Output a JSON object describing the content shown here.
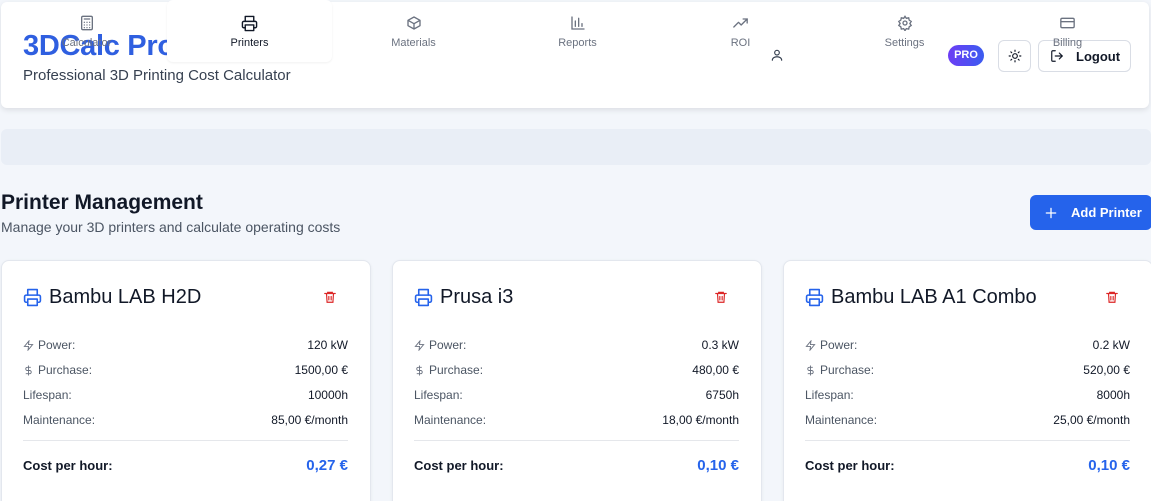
{
  "header": {
    "title": "3DCalc Pro",
    "subtitle": "Professional 3D Printing Cost Calculator",
    "badge": "PRO",
    "logout_label": "Logout",
    "icons": [
      "user-icon",
      "sun-icon",
      "logout-icon"
    ]
  },
  "tabs": [
    {
      "label": "Calculator",
      "icon": "calculator-icon",
      "active": false
    },
    {
      "label": "Printers",
      "icon": "printer-icon",
      "active": true
    },
    {
      "label": "Materials",
      "icon": "box-icon",
      "active": false
    },
    {
      "label": "Reports",
      "icon": "bar-chart-icon",
      "active": false
    },
    {
      "label": "ROI",
      "icon": "trending-up-icon",
      "active": false
    },
    {
      "label": "Settings",
      "icon": "gear-icon",
      "active": false
    },
    {
      "label": "Billing",
      "icon": "credit-card-icon",
      "active": false
    }
  ],
  "page": {
    "title": "Printer Management",
    "subtitle": "Manage your 3D printers and calculate operating costs",
    "add_button": "Add Printer"
  },
  "labels": {
    "power": "Power:",
    "purchase": "Purchase:",
    "lifespan": "Lifespan:",
    "maintenance": "Maintenance:",
    "cost_per_hour": "Cost per hour:"
  },
  "printers": [
    {
      "name": "Bambu LAB H2D",
      "power": "120 kW",
      "purchase": "1500,00 €",
      "lifespan": "10000h",
      "maintenance": "85,00 €/month",
      "cost_per_hour": "0,27 €"
    },
    {
      "name": "Prusa i3",
      "power": "0.3 kW",
      "purchase": "480,00 €",
      "lifespan": "6750h",
      "maintenance": "18,00 €/month",
      "cost_per_hour": "0,10 €"
    },
    {
      "name": "Bambu LAB A1 Combo",
      "power": "0.2 kW",
      "purchase": "520,00 €",
      "lifespan": "8000h",
      "maintenance": "25,00 €/month",
      "cost_per_hour": "0,10 €"
    }
  ],
  "colors": {
    "accent": "#2563eb",
    "title": "#2f5fe0",
    "delete": "#dc2626"
  }
}
